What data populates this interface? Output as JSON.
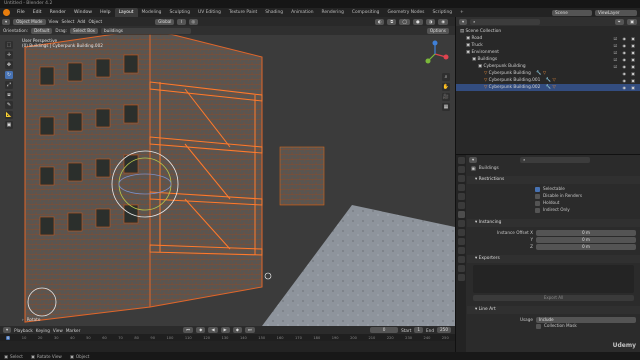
{
  "window_title": "Untitled - Blender 4.2",
  "menu": [
    "File",
    "Edit",
    "Render",
    "Window",
    "Help"
  ],
  "workspaces": [
    "Layout",
    "Modeling",
    "Sculpting",
    "UV Editing",
    "Texture Paint",
    "Shading",
    "Animation",
    "Rendering",
    "Compositing",
    "Geometry Nodes",
    "Scripting"
  ],
  "active_workspace": "Layout",
  "scene_label": "Scene",
  "view_layer_label": "ViewLayer",
  "viewport": {
    "mode": "Object Mode",
    "menus": [
      "View",
      "Select",
      "Add",
      "Object"
    ],
    "transform": "Global",
    "orientation_label": "Orientation:",
    "orientation_value": "Default",
    "drag_label": "Drag:",
    "drag_value": "Select Box",
    "search_value": "buildings",
    "options_label": "Options",
    "overlay_line1": "User Perspective",
    "overlay_line2": "(0) Buildings | Cyberpunk Building.002",
    "last_op": "Rotate"
  },
  "timeline": {
    "menus": [
      "Playback",
      "Keying",
      "View",
      "Marker"
    ],
    "current_frame": "0",
    "start_label": "Start",
    "start": "1",
    "end_label": "End",
    "end": "250",
    "ruler": [
      "0",
      "10",
      "20",
      "30",
      "40",
      "50",
      "60",
      "70",
      "80",
      "90",
      "100",
      "110",
      "120",
      "130",
      "140",
      "150",
      "160",
      "170",
      "180",
      "190",
      "200",
      "210",
      "220",
      "230",
      "240",
      "250"
    ]
  },
  "status": {
    "select": "Select",
    "rotate": "Rotate View",
    "object": "Object"
  },
  "outliner": {
    "search_placeholder": "",
    "rows": [
      {
        "label": "Scene Collection",
        "indent": 0,
        "selected": false
      },
      {
        "label": "Road",
        "indent": 1,
        "selected": false
      },
      {
        "label": "Truck",
        "indent": 1,
        "selected": false
      },
      {
        "label": "Environment",
        "indent": 1,
        "selected": false
      },
      {
        "label": "Buildings",
        "indent": 2,
        "selected": false
      },
      {
        "label": "Cyberpunk Building",
        "indent": 3,
        "selected": false
      },
      {
        "label": "Cyberpunk Building",
        "indent": 4,
        "selected": false
      },
      {
        "label": "Cyberpunk Building.001",
        "indent": 4,
        "selected": false
      },
      {
        "label": "Cyberpunk Building.002",
        "indent": 4,
        "selected": true
      }
    ]
  },
  "properties": {
    "collection_name": "Buildings",
    "restrictions": {
      "title": "Restrictions",
      "items": [
        {
          "label": "Selectable",
          "checked": true
        },
        {
          "label": "Disable in Renders",
          "checked": false
        },
        {
          "label": "Holdout",
          "checked": false
        },
        {
          "label": "Indirect Only",
          "checked": false
        }
      ]
    },
    "instancing": {
      "title": "Instancing",
      "offset_label": "Instance Offset X",
      "y_label": "Y",
      "z_label": "Z",
      "x": "0 m",
      "y": "0 m",
      "z": "0 m"
    },
    "exporters": {
      "title": "Exporters",
      "export_all": "Export All"
    },
    "line_art": {
      "title": "Line Art",
      "usage_label": "Usage",
      "usage_value": "Include",
      "collection_mask": "Collection Mask"
    }
  },
  "watermark": "Udemy",
  "colors": {
    "accent_blue": "#4772b3",
    "selection": "#334d80",
    "orange": "#e87d0d"
  }
}
